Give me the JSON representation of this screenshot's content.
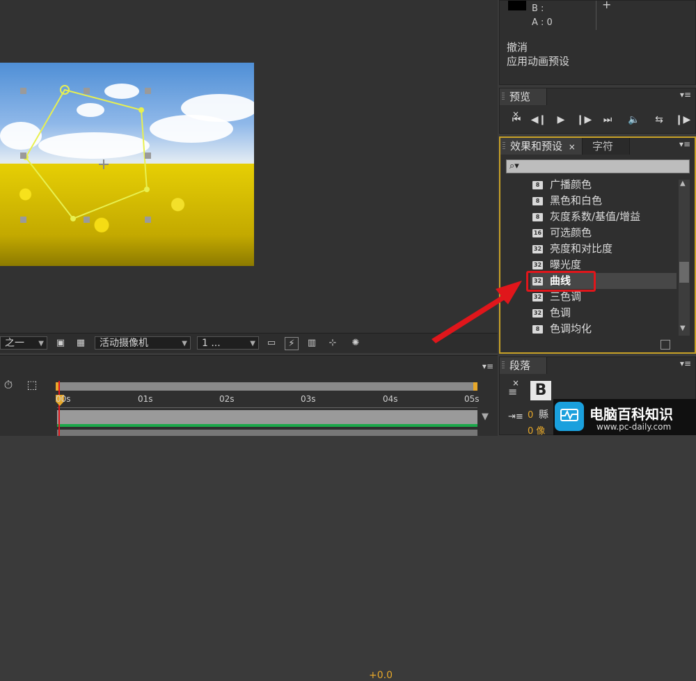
{
  "info_panel": {
    "b_label": "B :",
    "a_label": "A : 0",
    "plus": "+",
    "undo_label": "撤消",
    "history_item": "应用动画预设"
  },
  "preview_panel": {
    "tab": "预览",
    "close": "×",
    "menu": "▾≡",
    "buttons": [
      "first-frame",
      "prev-frame",
      "play",
      "next-frame",
      "last-frame",
      "audio",
      "loop",
      "ram-preview"
    ]
  },
  "effects_panel": {
    "tab_active": "效果和预设",
    "tab_inactive": "字符",
    "close": "×",
    "menu": "▾≡",
    "search_placeholder": "",
    "items": [
      {
        "label": "广播颜色",
        "badge": "8"
      },
      {
        "label": "黑色和白色",
        "badge": "8"
      },
      {
        "label": "灰度系数/基值/增益",
        "badge": "8"
      },
      {
        "label": "可选颜色",
        "badge": "16"
      },
      {
        "label": "亮度和对比度",
        "badge": "32"
      },
      {
        "label": "曝光度",
        "badge": "32"
      },
      {
        "label": "曲线",
        "badge": "32"
      },
      {
        "label": "三色调",
        "badge": "32"
      },
      {
        "label": "色调",
        "badge": "32"
      },
      {
        "label": "色调均化",
        "badge": "8"
      }
    ],
    "highlighted_item": "曲线",
    "highlight_color": "#e0161b"
  },
  "paragraph_panel": {
    "tab": "段落",
    "close": "×",
    "menu": "▾≡",
    "fragment_a": "0",
    "fragment_b": "0 像",
    "fragment_c": "縣"
  },
  "comp_toolbar": {
    "magnification_suffix": "之一",
    "camera": "活动摄像机",
    "view": "1 ...",
    "exposure": "+0.0",
    "exposure_color": "#e7a82a"
  },
  "timeline": {
    "menu": "▾≡",
    "ticks": [
      "00s",
      "01s",
      "02s",
      "03s",
      "04s",
      "05s"
    ]
  },
  "watermark": {
    "title": "电脑百科知识",
    "url": "www.pc-daily.com"
  },
  "colors": {
    "mask_path": "#e8f050",
    "arrow": "#e0161b",
    "panel_border_active": "#c9a227"
  }
}
